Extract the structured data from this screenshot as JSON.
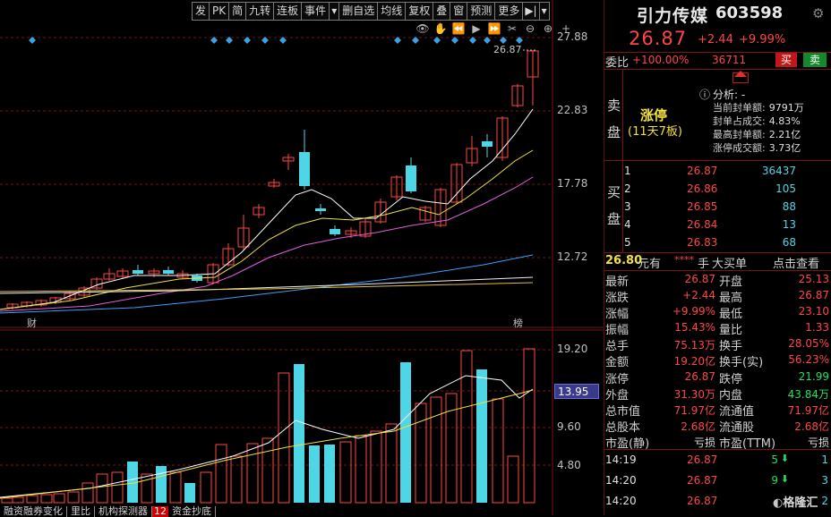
{
  "toolbar": [
    {
      "label": "发"
    },
    {
      "label": "PK"
    },
    {
      "label": "简"
    },
    {
      "label": "九转"
    },
    {
      "label": "连板"
    },
    {
      "label": "事件"
    },
    {
      "label": "▾"
    },
    {
      "label": "删自选"
    },
    {
      "label": "均线"
    },
    {
      "label": "复权"
    },
    {
      "label": "叠"
    },
    {
      "label": "窗"
    },
    {
      "label": "预测"
    },
    {
      "label": "更多"
    },
    {
      "label": "▶|"
    },
    {
      "label": "▾"
    }
  ],
  "tool_icons": [
    "eye-icon",
    "hand-icon",
    "back-icon",
    "play-icon",
    "forward-icon",
    "cut-icon",
    "zoom-out-icon",
    "zoom-in-icon",
    "plus-icon"
  ],
  "chart": {
    "price_axis": [
      "27.88",
      "22.83",
      "17.78",
      "12.72"
    ],
    "volume_axis": [
      "19.20",
      "13.95",
      "9.60",
      "4.80"
    ],
    "latest_price_tag": "26.87",
    "left_marker": "财",
    "right_marker": "榜"
  },
  "bottom_tabs": [
    "融资融券变化",
    "里比",
    "机构探测器",
    "12",
    "资金抄底"
  ],
  "stock": {
    "name": "引力传媒",
    "code": "603598",
    "price": "26.87",
    "change": "+2.44",
    "pct": "+9.99%"
  },
  "commission": {
    "label": "委比",
    "ratio": "+100.00%",
    "diff": "36711",
    "sell_btn": "买",
    "buy_btn": "卖"
  },
  "limit_up": {
    "sell_label": "卖盘",
    "status": "涨停",
    "streak": "(11天7板)",
    "analysis": "分析: -",
    "metrics": [
      {
        "label": "当前封单额:",
        "value": "9791万"
      },
      {
        "label": "封单占成交:",
        "value": "4.83%"
      },
      {
        "label": "最高封单额:",
        "value": "2.21亿"
      },
      {
        "label": "涨停成交额:",
        "value": "3.73亿"
      }
    ]
  },
  "buy_side": {
    "label": "买盘",
    "levels": [
      {
        "level": "1",
        "price": "26.87",
        "volume": "36437"
      },
      {
        "level": "2",
        "price": "26.86",
        "volume": "105"
      },
      {
        "level": "3",
        "price": "26.85",
        "volume": "88"
      },
      {
        "level": "4",
        "price": "26.84",
        "volume": "13"
      },
      {
        "level": "5",
        "price": "26.83",
        "volume": "68"
      }
    ]
  },
  "big_order": {
    "price": "26.80",
    "text": "元有",
    "masked": "****",
    "unit": "手",
    "label": "大买单",
    "link": "点击查看"
  },
  "stats": [
    {
      "l1": "最新",
      "v1": "26.87",
      "l2": "开盘",
      "v2": "25.13"
    },
    {
      "l1": "涨跌",
      "v1": "+2.44",
      "l2": "最高",
      "v2": "26.87"
    },
    {
      "l1": "涨幅",
      "v1": "+9.99%",
      "l2": "最低",
      "v2": "23.10"
    },
    {
      "l1": "振幅",
      "v1": "15.43%",
      "l2": "量比",
      "v2": "1.33"
    },
    {
      "l1": "总手",
      "v1": "75.13万",
      "l2": "换手",
      "v2": "28.05%"
    },
    {
      "l1": "金额",
      "v1": "19.20亿",
      "l2": "换手(实)",
      "v2": "56.23%"
    },
    {
      "l1": "涨停",
      "v1": "26.87",
      "l2": "跌停",
      "v2": "21.99"
    },
    {
      "l1": "外盘",
      "v1": "31.30万",
      "l2": "内盘",
      "v2": "43.84万"
    },
    {
      "l1": "总市值",
      "v1": "71.97亿",
      "l2": "流通值",
      "v2": "71.97亿"
    },
    {
      "l1": "总股本",
      "v1": "2.68亿",
      "l2": "流通股",
      "v2": "2.68亿"
    },
    {
      "l1": "市盈(静)",
      "v1": "亏损",
      "l2": "市盈(TTM)",
      "v2": "亏损"
    }
  ],
  "ticks": [
    {
      "time": "14:19",
      "price": "26.87",
      "volume": "5",
      "count": "1"
    },
    {
      "time": "14:20",
      "price": "26.87",
      "volume": "9",
      "count": "3"
    },
    {
      "time": "14:20",
      "price": "26.87",
      "volume": "",
      "count": "2"
    }
  ],
  "watermark": "格隆汇",
  "colors": {
    "up": "#ff4646",
    "down": "#4fd6e6",
    "ma5": "#ffffff",
    "ma10": "#f0e040",
    "ma20": "#e060e0",
    "ma60": "#3aa0ff",
    "grid": "#7a1414"
  }
}
